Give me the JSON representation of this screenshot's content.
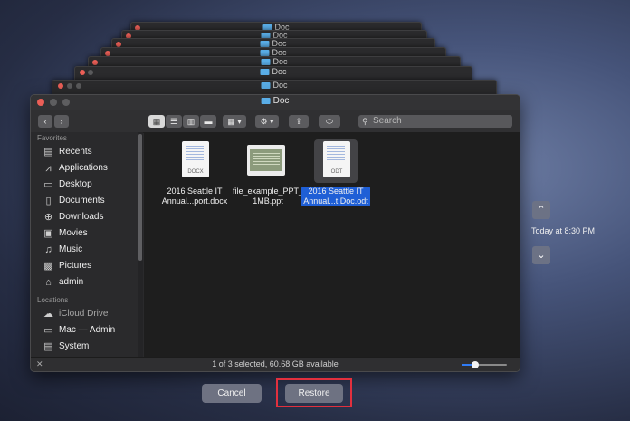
{
  "stack_window_title": "Doc",
  "window": {
    "title": "Doc",
    "search_placeholder": "Search"
  },
  "toolbar": {
    "nav_back": "‹",
    "nav_forward": "›",
    "view_icons": "■■■",
    "group": "▦",
    "action": "⚙",
    "share": "⇪",
    "tag": "⬭"
  },
  "sidebar": {
    "favorites_header": "Favorites",
    "favorites": [
      {
        "label": "Recents",
        "icon": "recents-icon"
      },
      {
        "label": "Applications",
        "icon": "applications-icon"
      },
      {
        "label": "Desktop",
        "icon": "desktop-icon"
      },
      {
        "label": "Documents",
        "icon": "documents-icon"
      },
      {
        "label": "Downloads",
        "icon": "downloads-icon"
      },
      {
        "label": "Movies",
        "icon": "movies-icon"
      },
      {
        "label": "Music",
        "icon": "music-icon"
      },
      {
        "label": "Pictures",
        "icon": "pictures-icon"
      },
      {
        "label": "admin",
        "icon": "home-icon"
      }
    ],
    "locations_header": "Locations",
    "locations": [
      {
        "label": "iCloud Drive",
        "icon": "cloud-icon"
      },
      {
        "label": "Mac — Admin",
        "icon": "computer-icon"
      },
      {
        "label": "System",
        "icon": "disk-icon"
      }
    ]
  },
  "files": [
    {
      "name_line1": "2016 Seattle IT",
      "name_line2": "Annual...port.docx",
      "ext": "DOCX",
      "selected": false
    },
    {
      "name_line1": "file_example_PPT_",
      "name_line2": "1MB.ppt",
      "ext": "",
      "selected": false
    },
    {
      "name_line1": "2016 Seattle IT",
      "name_line2": "Annual...t Doc.odt",
      "ext": "ODT",
      "selected": true
    }
  ],
  "status": {
    "text": "1 of 3 selected, 60.68 GB available",
    "zoom_level": 0.3
  },
  "time_machine": {
    "up": "⌃",
    "down": "⌄",
    "timestamp": "Today at 8:30 PM"
  },
  "buttons": {
    "cancel": "Cancel",
    "restore": "Restore"
  },
  "colors": {
    "selection": "#1f5fd6",
    "highlight": "#e2303e"
  }
}
